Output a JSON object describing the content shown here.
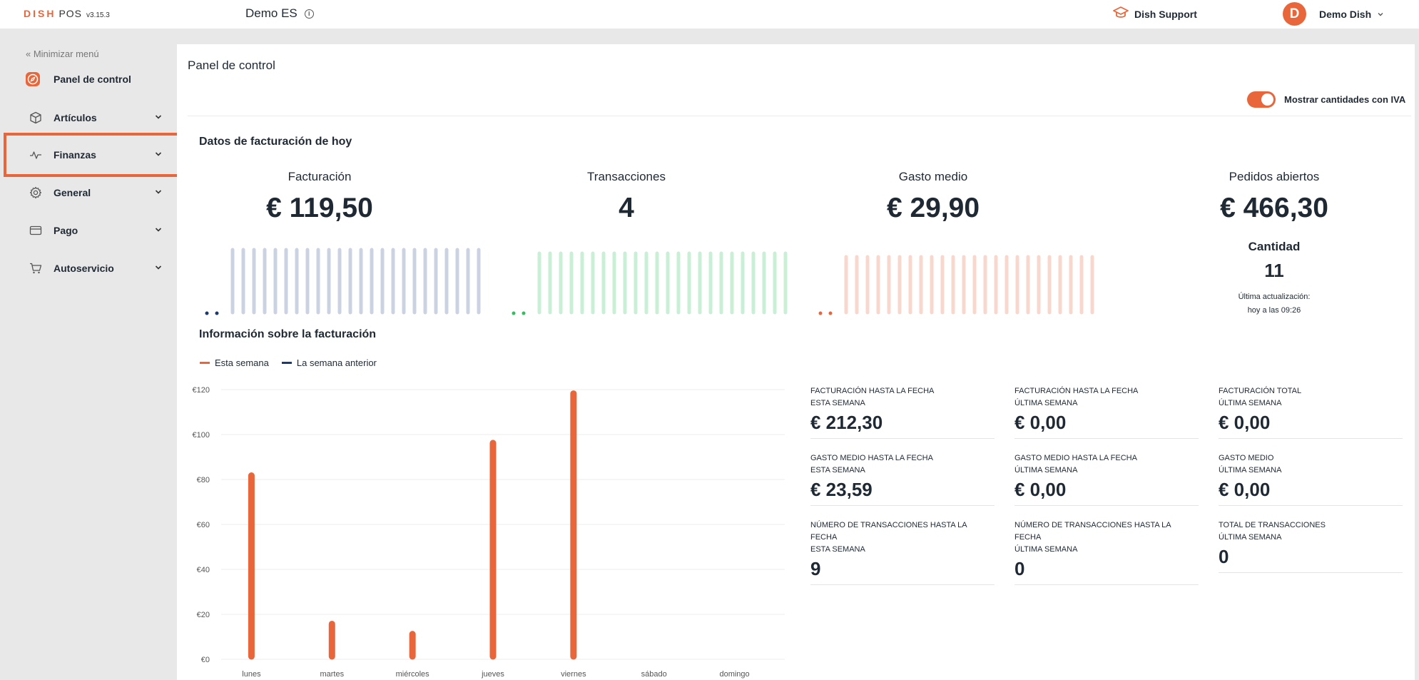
{
  "topbar": {
    "logo_main": "DISH",
    "logo_pos": "POS",
    "version": "v3.15.3",
    "company": "Demo ES",
    "support_label": "Dish Support",
    "user_initial": "D",
    "user_name": "Demo Dish"
  },
  "sidebar": {
    "minimize_label": "Minimizar menú",
    "items": [
      {
        "label": "Panel de control",
        "icon": "compass-icon"
      },
      {
        "label": "Artículos",
        "icon": "box-icon"
      },
      {
        "label": "Finanzas",
        "icon": "activity-icon"
      },
      {
        "label": "General",
        "icon": "gear-icon"
      },
      {
        "label": "Pago",
        "icon": "card-icon"
      },
      {
        "label": "Autoservicio",
        "icon": "cart-icon"
      }
    ]
  },
  "main": {
    "page_title": "Panel de control",
    "toggle_label": "Mostrar cantidades con IVA",
    "today_title": "Datos de facturación de hoy",
    "kpis": [
      {
        "title": "Facturación",
        "value": "€ 119,50"
      },
      {
        "title": "Transacciones",
        "value": "4"
      },
      {
        "title": "Gasto medio",
        "value": "€ 29,90"
      },
      {
        "title": "Pedidos abiertos",
        "value": "€ 466,30"
      }
    ],
    "open_orders": {
      "count_label": "Cantidad",
      "count_value": "11",
      "updated_line1": "Última actualización:",
      "updated_line2": "hoy a las 09:26"
    },
    "info_title": "Información sobre la facturación",
    "legend": {
      "this_week": "Esta semana",
      "last_week": "La semana anterior"
    },
    "metrics": [
      {
        "l1": "FACTURACIÓN HASTA LA FECHA",
        "l2": "ESTA SEMANA",
        "value": "€ 212,30"
      },
      {
        "l1": "FACTURACIÓN HASTA LA FECHA",
        "l2": "ÚLTIMA SEMANA",
        "value": "€ 0,00"
      },
      {
        "l1": "FACTURACIÓN TOTAL",
        "l2": "ÚLTIMA SEMANA",
        "value": "€ 0,00"
      },
      {
        "l1": "GASTO MEDIO HASTA LA FECHA",
        "l2": "ESTA SEMANA",
        "value": "€ 23,59"
      },
      {
        "l1": "GASTO MEDIO HASTA LA FECHA",
        "l2": "ÚLTIMA SEMANA",
        "value": "€ 0,00"
      },
      {
        "l1": "GASTO MEDIO",
        "l2": "ÚLTIMA SEMANA",
        "value": "€ 0,00"
      },
      {
        "l1": "NÚMERO DE TRANSACCIONES HASTA LA FECHA",
        "l2": "ESTA SEMANA",
        "value": "9"
      },
      {
        "l1": "NÚMERO DE TRANSACCIONES HASTA LA FECHA",
        "l2": "ÚLTIMA SEMANA",
        "value": "0"
      },
      {
        "l1": "TOTAL DE TRANSACCIONES",
        "l2": "ÚLTIMA SEMANA",
        "value": "0"
      }
    ]
  },
  "colors": {
    "accent": "#e8663a",
    "last_week": "#1d3a6e",
    "spark_revenue": "#cbd3e3",
    "spark_transactions": "#c9f0d6",
    "spark_avg": "#f8d7cc"
  },
  "chart_data": {
    "type": "bar",
    "categories": [
      "lunes",
      "martes",
      "miércoles",
      "jueves",
      "viernes",
      "sábado",
      "domingo"
    ],
    "series": [
      {
        "name": "Esta semana",
        "values": [
          83,
          17,
          12.5,
          97.5,
          119.5,
          0,
          0
        ]
      },
      {
        "name": "La semana anterior",
        "values": [
          0,
          0,
          0,
          0,
          0,
          0,
          0
        ]
      }
    ],
    "yticks": [
      "€0",
      "€20",
      "€40",
      "€60",
      "€80",
      "€100",
      "€120"
    ],
    "ylim": [
      0,
      120
    ],
    "grid": true,
    "legend": "top-left"
  }
}
